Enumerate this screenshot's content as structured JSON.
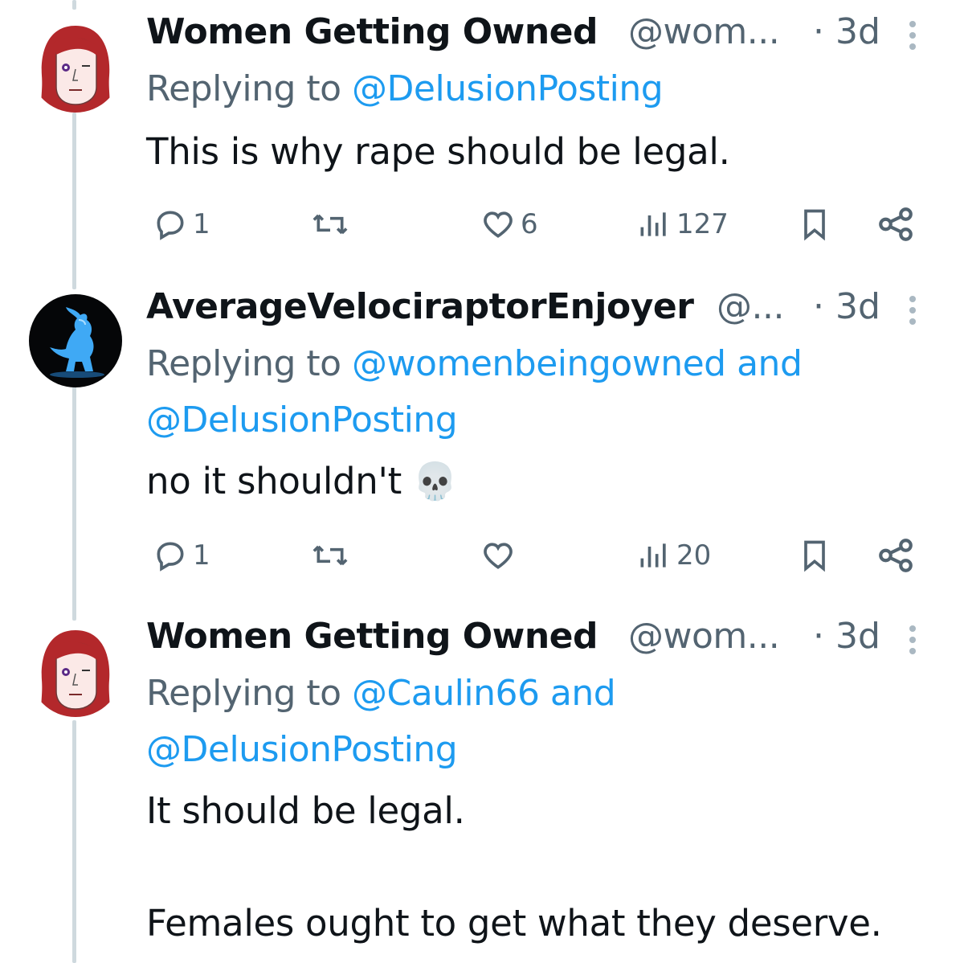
{
  "tweets": [
    {
      "name": "Women Getting Owned",
      "handle": "@wom...",
      "time": "· 3d",
      "replying_prefix": "Replying to ",
      "replying_line1": "@DelusionPosting",
      "replying_line2": "",
      "body": [
        "This is why rape should be legal."
      ],
      "actions": {
        "replies": "1",
        "retweets": "",
        "likes": "6",
        "views": "127"
      },
      "avatar_icon": "red-hair-woman-avatar"
    },
    {
      "name": "AverageVelociraptorEnjoyer",
      "handle": "@...",
      "time": "· 3d",
      "replying_prefix": "Replying to ",
      "replying_line1": "@womenbeingowned and",
      "replying_line2": "@DelusionPosting",
      "body": [
        "no it shouldn't 💀"
      ],
      "actions": {
        "replies": "1",
        "retweets": "",
        "likes": "",
        "views": "20"
      },
      "avatar_icon": "blue-dinosaur-avatar"
    },
    {
      "name": "Women Getting Owned",
      "handle": "@wom...",
      "time": "· 3d",
      "replying_prefix": "Replying to ",
      "replying_line1": "@Caulin66 and",
      "replying_line2": "@DelusionPosting",
      "body": [
        "It should be legal.",
        "",
        "Females ought to get what they deserve."
      ],
      "actions": {
        "replies": "",
        "retweets": "",
        "likes": "",
        "views": ""
      },
      "avatar_icon": "red-hair-woman-avatar"
    }
  ],
  "colors": {
    "link": "#1d9bf0",
    "secondary": "#536471",
    "text": "#0f1419",
    "thread_line": "#cfd9de"
  }
}
